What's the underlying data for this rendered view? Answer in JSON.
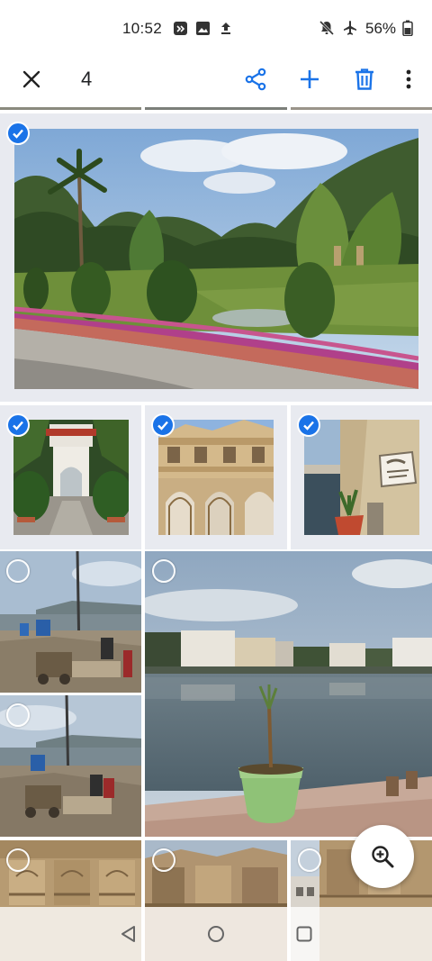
{
  "status_bar": {
    "time": "10:52",
    "battery_percent": "56%",
    "icons": [
      "screen-record-icon",
      "image-icon",
      "upload-icon",
      "notifications-off-icon",
      "airplane-icon",
      "battery-icon"
    ]
  },
  "action_bar": {
    "selected_count": "4",
    "actions": [
      "close-icon",
      "share-icon",
      "add-icon",
      "delete-icon",
      "more-vert-icon"
    ]
  },
  "colors": {
    "accent": "#1a73e8",
    "icon_dark": "#222222",
    "selected_bg": "#e8eaf0"
  },
  "photos": [
    {
      "id": "garden",
      "selected": true
    },
    {
      "id": "temple-gate",
      "selected": true
    },
    {
      "id": "palace-arches",
      "selected": true
    },
    {
      "id": "lakeside-plaque",
      "selected": true
    },
    {
      "id": "ghat-1",
      "selected": false
    },
    {
      "id": "lake-plant",
      "selected": false
    },
    {
      "id": "ghat-2",
      "selected": false
    },
    {
      "id": "carving-1",
      "selected": false
    },
    {
      "id": "carving-2",
      "selected": false
    },
    {
      "id": "carving-3",
      "selected": false
    }
  ],
  "fab": {
    "icon": "zoom-in-icon"
  },
  "nav_bar": {
    "buttons": [
      "back-icon",
      "home-icon",
      "recents-icon"
    ]
  }
}
